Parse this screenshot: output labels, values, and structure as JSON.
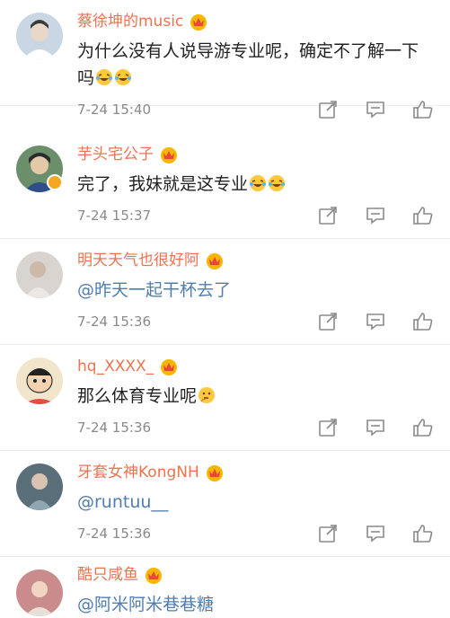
{
  "comments": [
    {
      "username": "蔡徐坤的music",
      "text": "为什么没有人说导游专业呢，确定不了解一下吗",
      "emojis": [
        "laughing-crying-emoji",
        "laughing-crying-emoji"
      ],
      "time": "7-24 15:40",
      "avatar": "avatar-portrait-icon",
      "avatar_color": "#c9d6e3",
      "verified": false
    },
    {
      "username": "芋头宅公子",
      "text": "完了，我妹就是这专业",
      "emojis": [
        "laughing-crying-emoji",
        "laughing-crying-emoji"
      ],
      "time": "7-24 15:37",
      "avatar": "avatar-portrait-icon",
      "avatar_color": "#6b8f6a",
      "verified": true
    },
    {
      "username": "明天天气也很好阿",
      "text": "@昨天一起干杯去了",
      "emojis": [],
      "time": "7-24 15:36",
      "avatar": "avatar-portrait-icon",
      "avatar_color": "#d8d4cf",
      "verified": false
    },
    {
      "username": "hq_XXXX_",
      "text": "那么体育专业呢",
      "emojis": [
        "thinking-emoji"
      ],
      "time": "7-24 15:36",
      "avatar": "avatar-cartoon-icon",
      "avatar_color": "#f1e6cc",
      "verified": false
    },
    {
      "username": "牙套女神KongNH",
      "text": "@runtuu__",
      "emojis": [],
      "time": "7-24 15:36",
      "avatar": "avatar-portrait-icon",
      "avatar_color": "#5a6f7a",
      "verified": false
    },
    {
      "username": "酷只咸鱼",
      "text": "@阿米阿米巷巷糖",
      "emojis": [],
      "time": "",
      "avatar": "avatar-portrait-icon",
      "avatar_color": "#c98b8b",
      "verified": false
    }
  ],
  "icons": {
    "crown": "vip-crown-icon",
    "repost": "repost-icon",
    "reply": "comment-icon",
    "like": "like-icon"
  },
  "colors": {
    "username": "#eb7350",
    "mention": "#507daf",
    "text": "#222222",
    "time": "#8a8a8a",
    "icon": "#8a8a8a"
  }
}
